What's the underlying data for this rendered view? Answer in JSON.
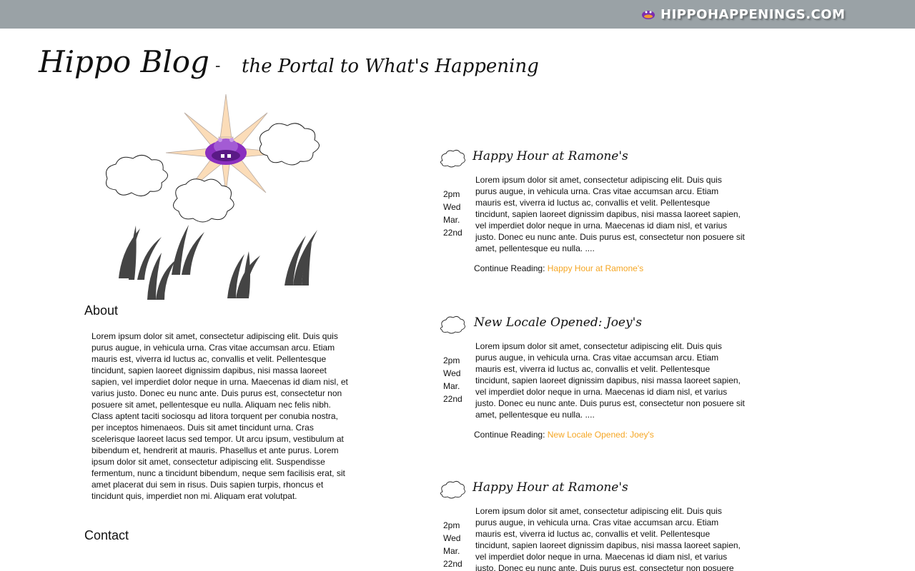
{
  "topbar": {
    "brand_text": "HIPPOHAPPENINGS.COM",
    "brand_color": "#ffffff",
    "bar_color": "#9aa2a6",
    "logo_icon": "hippo-logo-icon"
  },
  "header": {
    "title": "Hippo Blog",
    "separator": "-",
    "tagline": "the Portal to What's Happening"
  },
  "illustration": {
    "icons": [
      "sun-icon",
      "hippo-face-icon",
      "cloud-icon",
      "grass-icon"
    ]
  },
  "sidebar": {
    "about_heading": "About",
    "about_text": "Lorem ipsum dolor sit amet, consectetur adipiscing elit. Duis quis purus augue, in vehicula urna. Cras vitae accumsan arcu. Etiam mauris est, viverra id luctus ac, convallis et velit. Pellentesque tincidunt, sapien laoreet dignissim dapibus, nisi massa laoreet sapien, vel imperdiet dolor neque in urna. Maecenas id diam nisl, et varius justo. Donec eu nunc ante. Duis purus est, consectetur non posuere sit amet, pellentesque eu nulla. Aliquam nec felis nibh. Class aptent taciti sociosqu ad litora torquent per conubia nostra, per inceptos himenaeos. Duis sit amet tincidunt urna. Cras scelerisque laoreet lacus sed tempor. Ut arcu ipsum, vestibulum at bibendum et, hendrerit at mauris. Phasellus et ante purus. Lorem ipsum dolor sit amet, consectetur adipiscing elit. Suspendisse fermentum, nunc a tincidunt bibendum, neque sem facilisis erat, sit amet placerat dui sem in risus. Duis sapien turpis, rhoncus et tincidunt quis, imperdiet non mi. Aliquam erat volutpat.",
    "contact_heading": "Contact"
  },
  "posts": [
    {
      "title": "Happy Hour at Ramone's",
      "date": [
        "2pm",
        "Wed",
        "Mar.",
        "22nd"
      ],
      "body": "Lorem ipsum dolor sit amet, consectetur adipiscing elit. Duis quis purus augue, in vehicula urna. Cras vitae accumsan arcu. Etiam mauris est, viverra id luctus ac, convallis et velit. Pellentesque tincidunt, sapien laoreet dignissim dapibus, nisi massa laoreet sapien, vel imperdiet dolor neque in urna. Maecenas id diam nisl, et varius justo. Donec eu nunc ante. Duis purus est, consectetur non posuere sit amet, pellentesque eu nulla. ....",
      "continue_label": "Continue Reading:",
      "continue_link": "Happy Hour at Ramone's"
    },
    {
      "title": "New Locale Opened: Joey's",
      "date": [
        "2pm",
        "Wed",
        "Mar.",
        "22nd"
      ],
      "body": "Lorem ipsum dolor sit amet, consectetur adipiscing elit. Duis quis purus augue, in vehicula urna. Cras vitae accumsan arcu. Etiam mauris est, viverra id luctus ac, convallis et velit. Pellentesque tincidunt, sapien laoreet dignissim dapibus, nisi massa laoreet sapien, vel imperdiet dolor neque in urna. Maecenas id diam nisl, et varius justo. Donec eu nunc ante. Duis purus est, consectetur non posuere sit amet, pellentesque eu nulla. ....",
      "continue_label": "Continue Reading:",
      "continue_link": "New Locale Opened: Joey's"
    },
    {
      "title": "Happy Hour at Ramone's",
      "date": [
        "2pm",
        "Wed",
        "Mar.",
        "22nd"
      ],
      "body": "Lorem ipsum dolor sit amet, consectetur adipiscing elit. Duis quis purus augue, in vehicula urna. Cras vitae accumsan arcu. Etiam mauris est, viverra id luctus ac, convallis et velit. Pellentesque tincidunt, sapien laoreet dignissim dapibus, nisi massa laoreet sapien, vel imperdiet dolor neque in urna. Maecenas id diam nisl, et varius justo. Donec eu nunc ante. Duis purus est, consectetur non posuere"
    }
  ],
  "colors": {
    "link": "#f5a623",
    "sun_rays": "#fbdcb8",
    "hippo": "#8a2fbf",
    "grass": "#444444"
  }
}
